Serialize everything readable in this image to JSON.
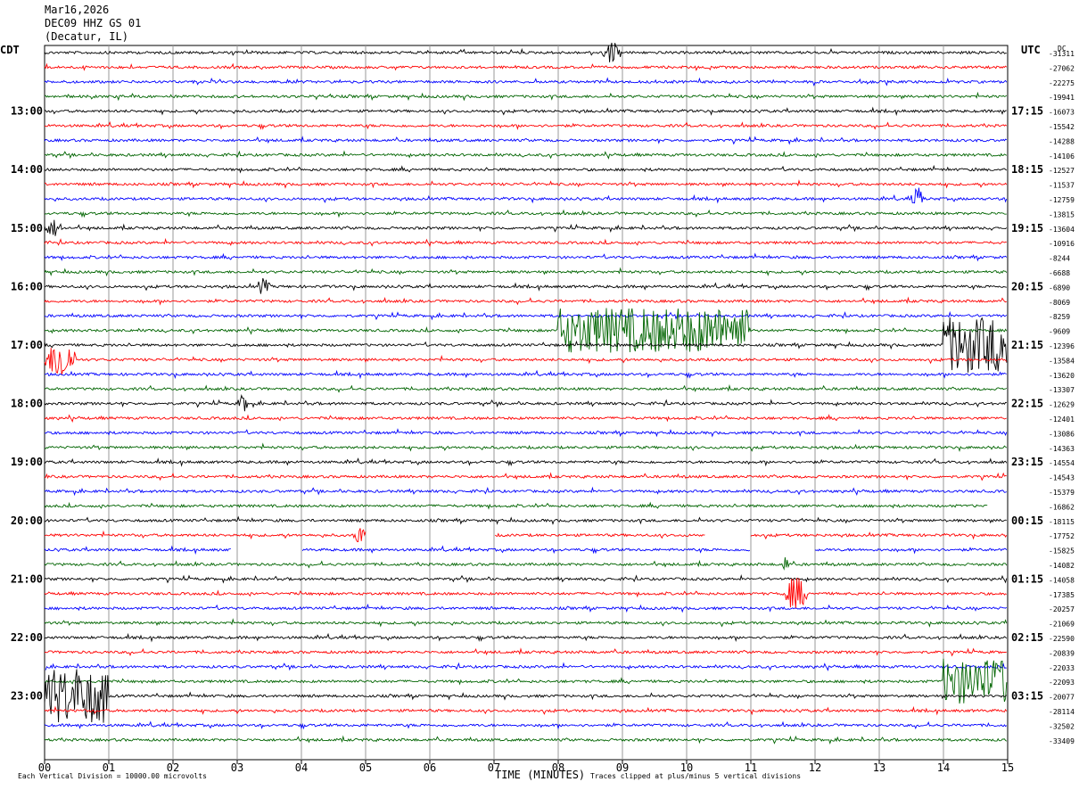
{
  "header": {
    "date": "Mar16,2026",
    "station": "DEC09 HHZ GS 01",
    "location": "(Decatur, IL)"
  },
  "left_timezone": "CDT",
  "right_timezone": "UTC",
  "dc_label": "DC",
  "footer": {
    "scale_note": "Each Vertical Division = 10000.00 microvolts",
    "xlabel": "TIME (MINUTES)",
    "clip_note": "Traces clipped at plus/minus 5 vertical divisions"
  },
  "colors": {
    "trace_cycle": [
      "#000000",
      "#ff0000",
      "#0000ff",
      "#006400"
    ],
    "grid": "#999999"
  },
  "chart_data": {
    "type": "line",
    "title": "DEC09 HHZ GS 01 (Decatur, IL)",
    "xlabel": "TIME (MINUTES)",
    "xlim": [
      0,
      15
    ],
    "x_ticks": [
      "00",
      "01",
      "02",
      "03",
      "04",
      "05",
      "06",
      "07",
      "08",
      "09",
      "10",
      "11",
      "12",
      "13",
      "14",
      "15"
    ],
    "rows_per_hour": 4,
    "left_hour_labels": [
      "13:00",
      "14:00",
      "15:00",
      "16:00",
      "17:00",
      "18:00",
      "19:00",
      "20:00",
      "21:00",
      "22:00",
      "23:00"
    ],
    "right_hour_labels": [
      "17:15",
      "18:15",
      "19:15",
      "20:15",
      "21:15",
      "22:15",
      "23:15",
      "00:15",
      "01:15",
      "02:15",
      "03:15"
    ],
    "dc_offsets": [
      -31311,
      -27062,
      -22275,
      -19941,
      -16073,
      -15542,
      -14288,
      -14106,
      -12527,
      -11537,
      -12759,
      -13815,
      -13604,
      -10916,
      -8244,
      -6688,
      -6890,
      -8069,
      -8259,
      -9609,
      -12396,
      -13584,
      -13620,
      -13307,
      -12629,
      -12401,
      -13086,
      -14363,
      -14554,
      -14543,
      -15379,
      -16862,
      -18115,
      -17752,
      -15825,
      -14082,
      -14058,
      -17385,
      -20257,
      -21069,
      -22590,
      -20839,
      -22033,
      -22093,
      -20077,
      -28114,
      -32502,
      -33409
    ],
    "events": [
      {
        "row": 0,
        "start_min": 8.7,
        "end_min": 9.0,
        "amp": 2
      },
      {
        "row": 10,
        "start_min": 13.5,
        "end_min": 13.7,
        "amp": 2
      },
      {
        "row": 12,
        "start_min": 0.0,
        "end_min": 0.3,
        "amp": 1.5
      },
      {
        "row": 16,
        "start_min": 3.3,
        "end_min": 3.5,
        "amp": 1.5
      },
      {
        "row": 19,
        "start_min": 8.0,
        "end_min": 11.0,
        "amp": 4
      },
      {
        "row": 20,
        "start_min": 14.0,
        "end_min": 15.0,
        "amp": 5
      },
      {
        "row": 21,
        "start_min": 0.0,
        "end_min": 0.5,
        "amp": 4
      },
      {
        "row": 24,
        "start_min": 3.0,
        "end_min": 3.2,
        "amp": 1.5
      },
      {
        "row": 33,
        "start_min": 4.8,
        "end_min": 5.0,
        "amp": 1.8
      },
      {
        "row": 35,
        "start_min": 11.5,
        "end_min": 11.6,
        "amp": 1.8
      },
      {
        "row": 37,
        "start_min": 11.5,
        "end_min": 11.9,
        "amp": 3
      },
      {
        "row": 43,
        "start_min": 14.0,
        "end_min": 15.0,
        "amp": 4
      },
      {
        "row": 44,
        "start_min": 0.0,
        "end_min": 1.0,
        "amp": 5
      }
    ],
    "gaps": [
      {
        "row": 33,
        "start_min": 5.0,
        "end_min": 7.0
      },
      {
        "row": 33,
        "start_min": 10.3,
        "end_min": 11.0
      },
      {
        "row": 34,
        "start_min": 2.9,
        "end_min": 4.0
      },
      {
        "row": 34,
        "start_min": 11.0,
        "end_min": 12.0
      },
      {
        "row": 42,
        "start_min": 0.0,
        "end_min": 0.01
      },
      {
        "row": 31,
        "start_min": 14.7,
        "end_min": 15.0
      }
    ]
  }
}
